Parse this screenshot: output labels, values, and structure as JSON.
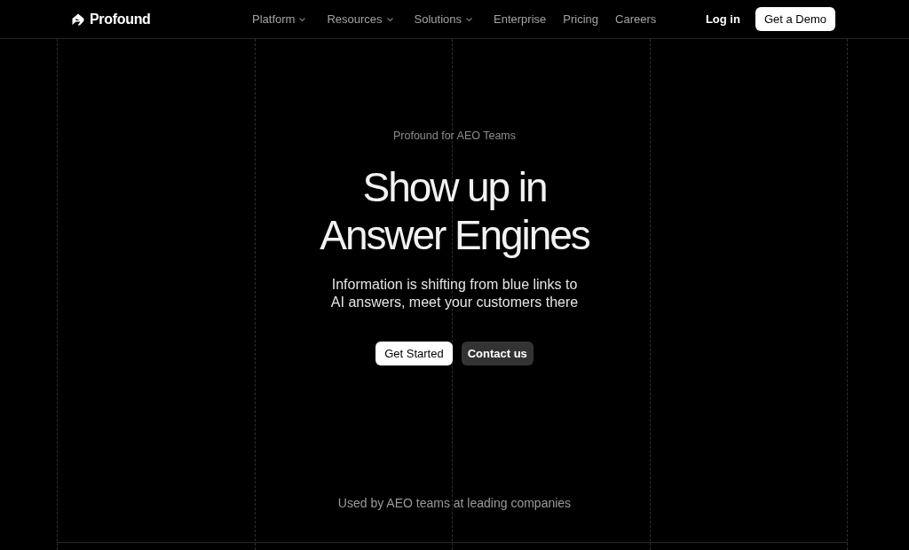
{
  "nav": {
    "brand": "Profound",
    "links": [
      {
        "label": "Platform",
        "kind": "dropdown"
      },
      {
        "label": "Resources",
        "kind": "dropdown"
      },
      {
        "label": "Solutions",
        "kind": "dropdown"
      },
      {
        "label": "Enterprise",
        "kind": "link"
      },
      {
        "label": "Pricing",
        "kind": "link"
      },
      {
        "label": "Careers",
        "kind": "link"
      }
    ],
    "login": "Log in",
    "cta": "Get a Demo"
  },
  "hero": {
    "eyebrow": "Profound for AEO Teams",
    "title_lines": [
      "Show up in",
      "Answer Engines"
    ],
    "subtitle": "Information is shifting from blue links to AI answers, meet your customers there",
    "buttons": [
      {
        "label": "Get Started",
        "kind": "primary"
      },
      {
        "label": "Contact us",
        "kind": "secondary"
      }
    ]
  },
  "customers": {
    "caption": "Used by AEO teams at leading companies"
  }
}
